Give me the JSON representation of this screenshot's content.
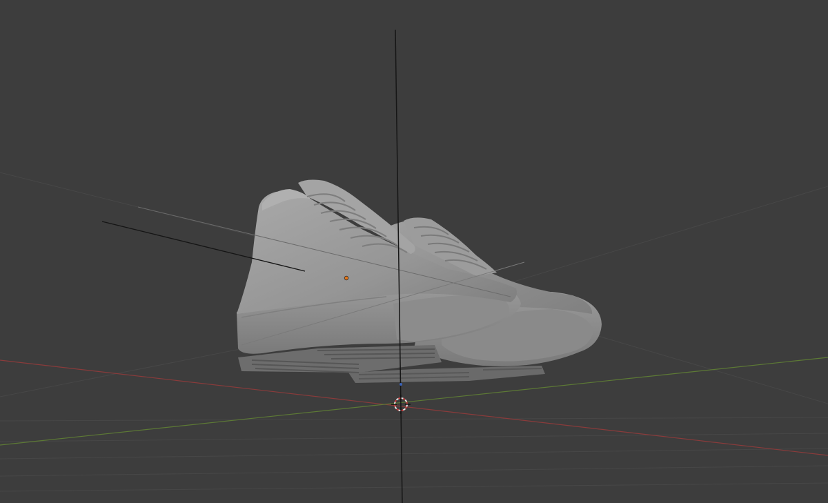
{
  "viewport": {
    "mode": "3d-viewport",
    "shading": "solid",
    "icons": {
      "cursor": "3d-cursor-icon",
      "origin": "object-origin-icon"
    },
    "colors": {
      "background": "#3d3d3d",
      "grid": "#4a4a4a",
      "x_axis": "#8a3b3b",
      "y_axis": "#5d7a35",
      "z_axis": "#1a1a1a",
      "mesh_light": "#a3a3a3",
      "mesh_mid": "#8f8f8f",
      "mesh_dark": "#6c6c6c",
      "origin_dot": "#e3761a"
    }
  }
}
